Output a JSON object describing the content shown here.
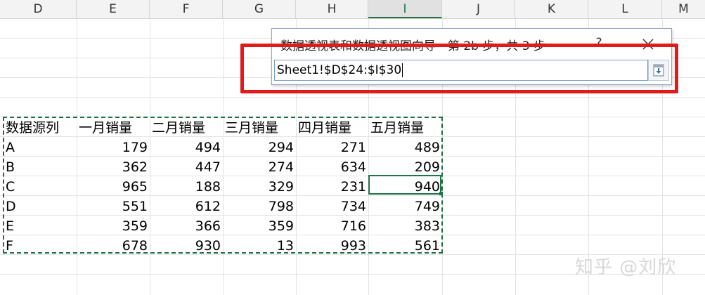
{
  "columns": [
    "D",
    "E",
    "F",
    "G",
    "H",
    "I",
    "J",
    "K",
    "L",
    "M"
  ],
  "active_column": "I",
  "dialog": {
    "title": "数据透视表和数据透视图向导 - 第 2b 步，共 3 步",
    "help_label": "?",
    "close_icon": "close-icon",
    "range_value": "Sheet1!$D$24:$I$30",
    "collapse_icon": "collapse-dialog-icon"
  },
  "table": {
    "headers": [
      "数据源列",
      "一月销量",
      "二月销量",
      "三月销量",
      "四月销量",
      "五月销量"
    ],
    "rows": [
      {
        "label": "A",
        "values": [
          179,
          494,
          294,
          271,
          489
        ]
      },
      {
        "label": "B",
        "values": [
          362,
          447,
          274,
          634,
          209
        ]
      },
      {
        "label": "C",
        "values": [
          965,
          188,
          329,
          231,
          940
        ]
      },
      {
        "label": "D",
        "values": [
          551,
          612,
          798,
          734,
          749
        ]
      },
      {
        "label": "E",
        "values": [
          359,
          366,
          359,
          716,
          383
        ]
      },
      {
        "label": "F",
        "values": [
          678,
          930,
          13,
          993,
          561
        ]
      }
    ]
  },
  "watermark": "知乎 @刘欣",
  "colors": {
    "highlight": "#e11a1a",
    "accent": "#217346",
    "marquee": "#1f6f43"
  }
}
